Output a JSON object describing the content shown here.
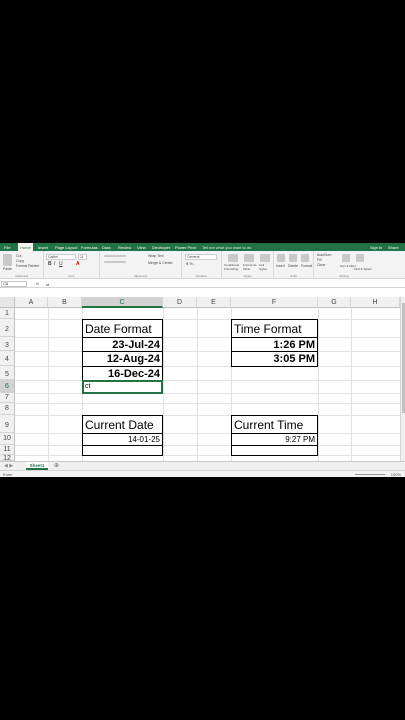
{
  "ribbon_tabs": [
    "File",
    "Home",
    "Insert",
    "Page Layout",
    "Formulas",
    "Data",
    "Review",
    "View",
    "Developer",
    "Power Pivot"
  ],
  "tell_me": "Tell me what you want to do",
  "sign_in": "Sign in",
  "share": "Share",
  "ribbon": {
    "cut": "Cut",
    "copy": "Copy",
    "format_painter": "Format Painter",
    "paste": "Paste",
    "clipboard": "Clipboard",
    "font_name": "Calibri",
    "font_size": "11",
    "font": "Font",
    "wrap_text": "Wrap Text",
    "merge_center": "Merge & Center",
    "alignment": "Alignment",
    "number_format": "General",
    "number": "Number",
    "conditional_formatting": "Conditional Formatting",
    "format_as_table": "Format as Table",
    "cell_styles": "Cell Styles",
    "styles": "Styles",
    "insert": "Insert",
    "delete": "Delete",
    "format": "Format",
    "cells": "Cells",
    "autosum": "AutoSum",
    "fill": "Fill",
    "clear": "Clear",
    "sort_filter": "Sort & Filter",
    "find_select": "Find & Select",
    "editing": "Editing"
  },
  "formula_bar": {
    "name_box": "C6",
    "fx": "fx",
    "content": "ct"
  },
  "columns": [
    "A",
    "B",
    "C",
    "D",
    "E",
    "F",
    "G",
    "H"
  ],
  "rows": [
    "1",
    "2",
    "3",
    "4",
    "5",
    "6",
    "7",
    "8",
    "9",
    "10",
    "11",
    "12"
  ],
  "cells": {
    "date_format_header": "Date Format",
    "date1": "23-Jul-24",
    "date2": "12-Aug-24",
    "date3": "16-Dec-24",
    "active_entry": "ct",
    "time_format_header": "Time Format",
    "time1": "1:26 PM",
    "time2": "3:05 PM",
    "current_date_header": "Current Date",
    "current_date_value": "14-01-25",
    "current_time_header": "Current Time",
    "current_time_value": "9:27 PM"
  },
  "sheet_tab": "Sheet1",
  "status": {
    "mode": "Enter",
    "zoom": "100%"
  },
  "accent": "#217346"
}
